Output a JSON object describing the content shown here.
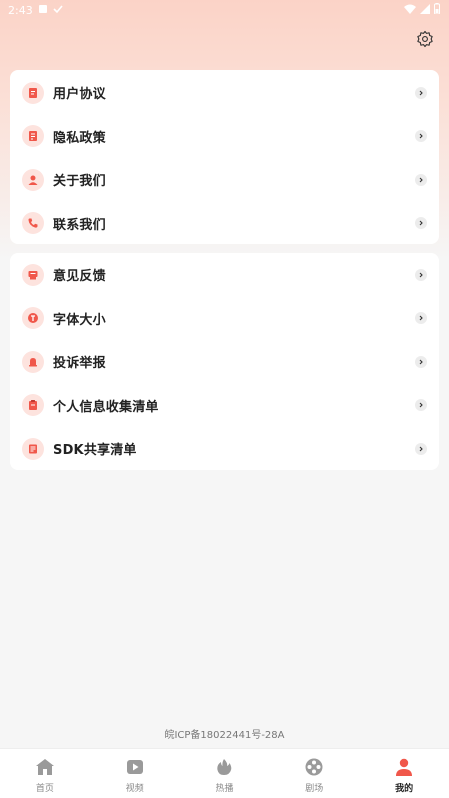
{
  "status_bar": {
    "time": "2:43",
    "left_icons": [
      "notification-icon",
      "check-icon"
    ],
    "right_icons": [
      "wifi-icon",
      "signal-icon",
      "battery-icon"
    ]
  },
  "header": {
    "settings_icon": "gear-icon"
  },
  "group1": [
    {
      "label": "用户协议",
      "icon": "document-icon"
    },
    {
      "label": "隐私政策",
      "icon": "privacy-doc-icon"
    },
    {
      "label": "关于我们",
      "icon": "person-icon"
    },
    {
      "label": "联系我们",
      "icon": "phone-icon"
    }
  ],
  "group2": [
    {
      "label": "意见反馈",
      "icon": "feedback-icon"
    },
    {
      "label": "字体大小",
      "icon": "font-size-icon"
    },
    {
      "label": "投诉举报",
      "icon": "bell-icon"
    },
    {
      "label": "个人信息收集清单",
      "icon": "clipboard-icon"
    },
    {
      "label": "SDK共享清单",
      "icon": "list-icon"
    }
  ],
  "footer": {
    "icp": "皖ICP备18022441号-28A"
  },
  "bottom_nav": [
    {
      "label": "首页",
      "icon": "home-icon",
      "active": false
    },
    {
      "label": "视频",
      "icon": "video-icon",
      "active": false
    },
    {
      "label": "热播",
      "icon": "fire-icon",
      "active": false
    },
    {
      "label": "剧场",
      "icon": "film-reel-icon",
      "active": false
    },
    {
      "label": "我的",
      "icon": "profile-icon",
      "active": true
    }
  ],
  "colors": {
    "accent": "#f0574a",
    "icon_bg": "#fde3de",
    "gradient_top": "#fbd3c7"
  }
}
